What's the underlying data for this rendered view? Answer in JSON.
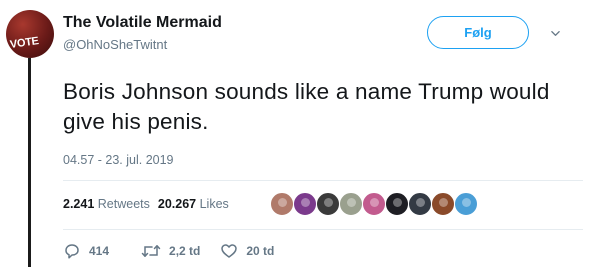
{
  "author": {
    "display_name": "The Volatile Mermaid",
    "handle": "@OhNoSheTwitnt",
    "avatar_text": "VOTE"
  },
  "follow_label": "Følg",
  "tweet": {
    "text": "Boris Johnson sounds like a name Trump would give his penis.",
    "timestamp": "04.57 - 23. jul. 2019"
  },
  "stats": {
    "retweets_count": "2.241",
    "retweets_label": "Retweets",
    "likes_count": "20.267",
    "likes_label": "Likes"
  },
  "likers": [
    {
      "color": "#b07a6a"
    },
    {
      "color": "#7b3a8c"
    },
    {
      "color": "#3a3a3a"
    },
    {
      "color": "#9aa08e"
    },
    {
      "color": "#c25b8e"
    },
    {
      "color": "#1e1e24"
    },
    {
      "color": "#333a44"
    },
    {
      "color": "#8a4a2a"
    },
    {
      "color": "#4a9ed6"
    }
  ],
  "actions": {
    "replies": "414",
    "retweets": "2,2 td",
    "likes": "20 td"
  },
  "colors": {
    "accent": "#1da1f2",
    "muted": "#657786",
    "text": "#14171a"
  }
}
